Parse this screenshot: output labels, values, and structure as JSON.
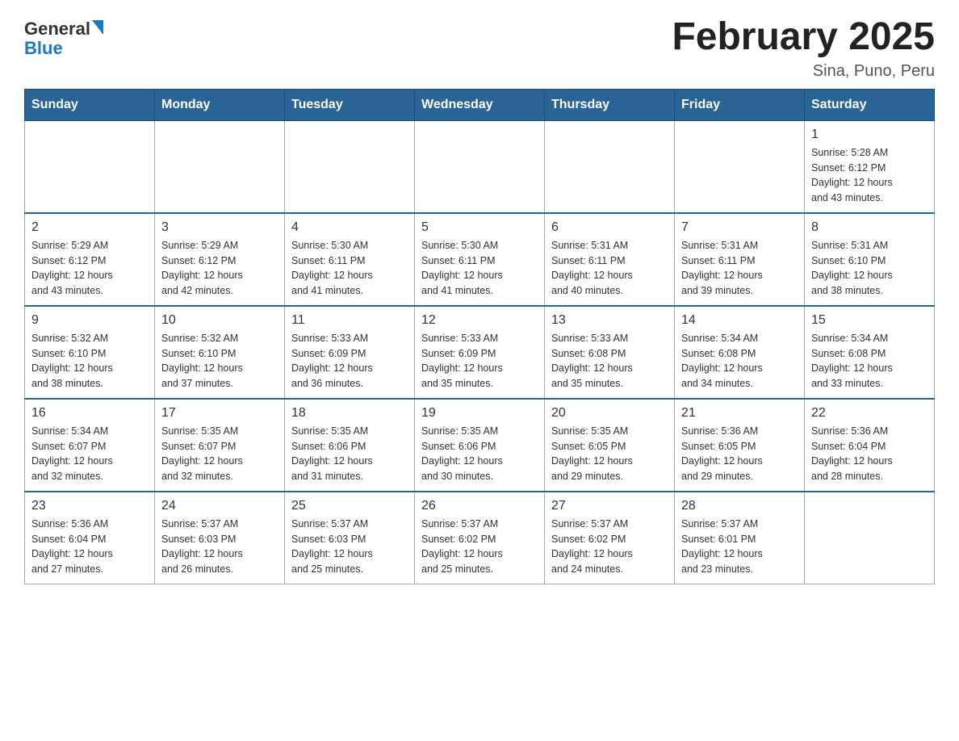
{
  "logo": {
    "text_general": "General",
    "text_blue": "Blue",
    "arrow_char": "▲"
  },
  "title": "February 2025",
  "location": "Sina, Puno, Peru",
  "days_of_week": [
    "Sunday",
    "Monday",
    "Tuesday",
    "Wednesday",
    "Thursday",
    "Friday",
    "Saturday"
  ],
  "weeks": [
    [
      {
        "day": "",
        "info": ""
      },
      {
        "day": "",
        "info": ""
      },
      {
        "day": "",
        "info": ""
      },
      {
        "day": "",
        "info": ""
      },
      {
        "day": "",
        "info": ""
      },
      {
        "day": "",
        "info": ""
      },
      {
        "day": "1",
        "info": "Sunrise: 5:28 AM\nSunset: 6:12 PM\nDaylight: 12 hours\nand 43 minutes."
      }
    ],
    [
      {
        "day": "2",
        "info": "Sunrise: 5:29 AM\nSunset: 6:12 PM\nDaylight: 12 hours\nand 43 minutes."
      },
      {
        "day": "3",
        "info": "Sunrise: 5:29 AM\nSunset: 6:12 PM\nDaylight: 12 hours\nand 42 minutes."
      },
      {
        "day": "4",
        "info": "Sunrise: 5:30 AM\nSunset: 6:11 PM\nDaylight: 12 hours\nand 41 minutes."
      },
      {
        "day": "5",
        "info": "Sunrise: 5:30 AM\nSunset: 6:11 PM\nDaylight: 12 hours\nand 41 minutes."
      },
      {
        "day": "6",
        "info": "Sunrise: 5:31 AM\nSunset: 6:11 PM\nDaylight: 12 hours\nand 40 minutes."
      },
      {
        "day": "7",
        "info": "Sunrise: 5:31 AM\nSunset: 6:11 PM\nDaylight: 12 hours\nand 39 minutes."
      },
      {
        "day": "8",
        "info": "Sunrise: 5:31 AM\nSunset: 6:10 PM\nDaylight: 12 hours\nand 38 minutes."
      }
    ],
    [
      {
        "day": "9",
        "info": "Sunrise: 5:32 AM\nSunset: 6:10 PM\nDaylight: 12 hours\nand 38 minutes."
      },
      {
        "day": "10",
        "info": "Sunrise: 5:32 AM\nSunset: 6:10 PM\nDaylight: 12 hours\nand 37 minutes."
      },
      {
        "day": "11",
        "info": "Sunrise: 5:33 AM\nSunset: 6:09 PM\nDaylight: 12 hours\nand 36 minutes."
      },
      {
        "day": "12",
        "info": "Sunrise: 5:33 AM\nSunset: 6:09 PM\nDaylight: 12 hours\nand 35 minutes."
      },
      {
        "day": "13",
        "info": "Sunrise: 5:33 AM\nSunset: 6:08 PM\nDaylight: 12 hours\nand 35 minutes."
      },
      {
        "day": "14",
        "info": "Sunrise: 5:34 AM\nSunset: 6:08 PM\nDaylight: 12 hours\nand 34 minutes."
      },
      {
        "day": "15",
        "info": "Sunrise: 5:34 AM\nSunset: 6:08 PM\nDaylight: 12 hours\nand 33 minutes."
      }
    ],
    [
      {
        "day": "16",
        "info": "Sunrise: 5:34 AM\nSunset: 6:07 PM\nDaylight: 12 hours\nand 32 minutes."
      },
      {
        "day": "17",
        "info": "Sunrise: 5:35 AM\nSunset: 6:07 PM\nDaylight: 12 hours\nand 32 minutes."
      },
      {
        "day": "18",
        "info": "Sunrise: 5:35 AM\nSunset: 6:06 PM\nDaylight: 12 hours\nand 31 minutes."
      },
      {
        "day": "19",
        "info": "Sunrise: 5:35 AM\nSunset: 6:06 PM\nDaylight: 12 hours\nand 30 minutes."
      },
      {
        "day": "20",
        "info": "Sunrise: 5:35 AM\nSunset: 6:05 PM\nDaylight: 12 hours\nand 29 minutes."
      },
      {
        "day": "21",
        "info": "Sunrise: 5:36 AM\nSunset: 6:05 PM\nDaylight: 12 hours\nand 29 minutes."
      },
      {
        "day": "22",
        "info": "Sunrise: 5:36 AM\nSunset: 6:04 PM\nDaylight: 12 hours\nand 28 minutes."
      }
    ],
    [
      {
        "day": "23",
        "info": "Sunrise: 5:36 AM\nSunset: 6:04 PM\nDaylight: 12 hours\nand 27 minutes."
      },
      {
        "day": "24",
        "info": "Sunrise: 5:37 AM\nSunset: 6:03 PM\nDaylight: 12 hours\nand 26 minutes."
      },
      {
        "day": "25",
        "info": "Sunrise: 5:37 AM\nSunset: 6:03 PM\nDaylight: 12 hours\nand 25 minutes."
      },
      {
        "day": "26",
        "info": "Sunrise: 5:37 AM\nSunset: 6:02 PM\nDaylight: 12 hours\nand 25 minutes."
      },
      {
        "day": "27",
        "info": "Sunrise: 5:37 AM\nSunset: 6:02 PM\nDaylight: 12 hours\nand 24 minutes."
      },
      {
        "day": "28",
        "info": "Sunrise: 5:37 AM\nSunset: 6:01 PM\nDaylight: 12 hours\nand 23 minutes."
      },
      {
        "day": "",
        "info": ""
      }
    ]
  ]
}
